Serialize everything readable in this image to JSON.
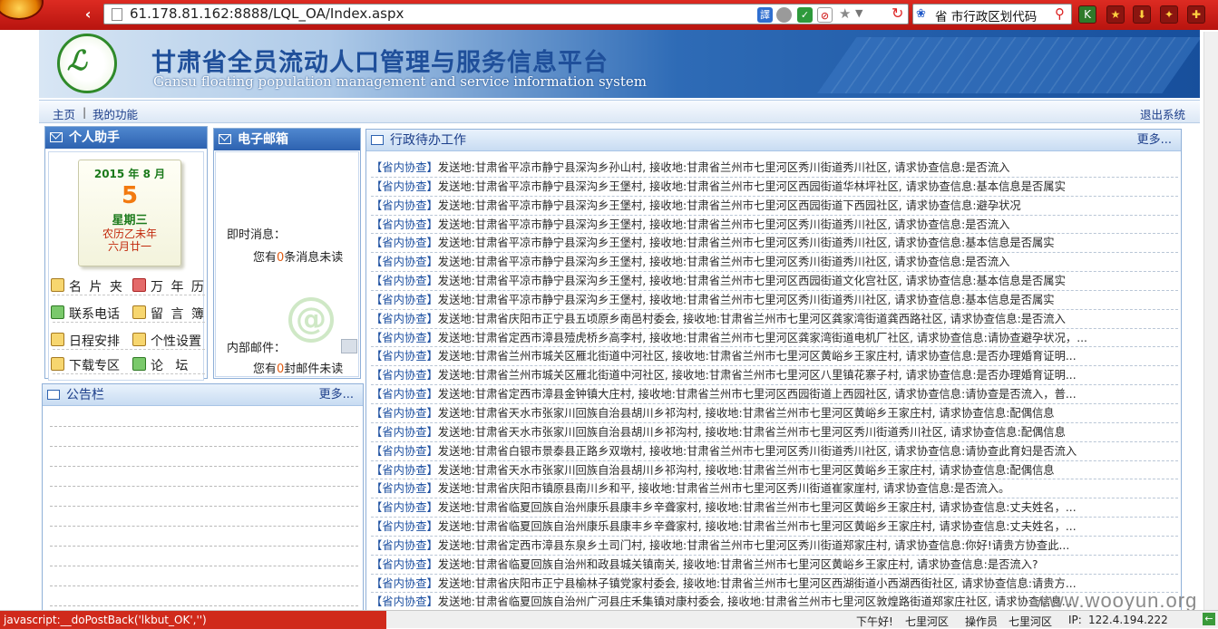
{
  "browser": {
    "url": "61.178.81.162:8888/LQL_OA/Index.aspx",
    "search_text": "省 市行政区划代码"
  },
  "banner": {
    "title": "甘肃省全员流动人口管理与服务信息平台",
    "subtitle": "Gansu floating population management and service information system"
  },
  "nav": {
    "home": "主页",
    "sep": "|",
    "my_functions": "我的功能",
    "logout": "退出系统"
  },
  "assistant": {
    "title": "个人助手",
    "calendar": {
      "year_month": "2015 年 8 月",
      "day": "5",
      "weekday": "星期三",
      "lunar_year": "农历乙未年",
      "lunar_date": "六月廿一"
    },
    "tools": [
      "名 片 夹",
      "万 年 历",
      "联系电话",
      "留 言 簿",
      "日程安排",
      "个性设置",
      "下载专区",
      "论   坛"
    ]
  },
  "mailbox": {
    "title": "电子邮箱",
    "instant_label": "即时消息：",
    "instant_prefix": "您有",
    "instant_count": "0",
    "instant_suffix": "条消息未读",
    "internal_label": "内部邮件：",
    "internal_prefix": "您有",
    "internal_count": "0",
    "internal_suffix": "封邮件未读"
  },
  "notice": {
    "title": "公告栏",
    "more": "更多..."
  },
  "work": {
    "title": "行政待办工作",
    "more": "更多...",
    "rows": [
      "【省内协查】发送地:甘肃省平凉市静宁县深沟乡孙山村, 接收地:甘肃省兰州市七里河区秀川街道秀川社区, 请求协查信息:是否流入",
      "【省内协查】发送地:甘肃省平凉市静宁县深沟乡王堡村, 接收地:甘肃省兰州市七里河区西园街道华林坪社区, 请求协查信息:基本信息是否属实",
      "【省内协查】发送地:甘肃省平凉市静宁县深沟乡王堡村, 接收地:甘肃省兰州市七里河区西园街道下西园社区, 请求协查信息:避孕状况",
      "【省内协查】发送地:甘肃省平凉市静宁县深沟乡王堡村, 接收地:甘肃省兰州市七里河区秀川街道秀川社区, 请求协查信息:是否流入",
      "【省内协查】发送地:甘肃省平凉市静宁县深沟乡王堡村, 接收地:甘肃省兰州市七里河区秀川街道秀川社区, 请求协查信息:基本信息是否属实",
      "【省内协查】发送地:甘肃省平凉市静宁县深沟乡王堡村, 接收地:甘肃省兰州市七里河区秀川街道秀川社区, 请求协查信息:是否流入",
      "【省内协查】发送地:甘肃省平凉市静宁县深沟乡王堡村, 接收地:甘肃省兰州市七里河区西园街道文化宫社区, 请求协查信息:基本信息是否属实",
      "【省内协查】发送地:甘肃省平凉市静宁县深沟乡王堡村, 接收地:甘肃省兰州市七里河区秀川街道秀川社区, 请求协查信息:基本信息是否属实",
      "【省内协查】发送地:甘肃省庆阳市正宁县五顷原乡南邑村委会, 接收地:甘肃省兰州市七里河区龚家湾街道龚西路社区, 请求协查信息:是否流入",
      "【省内协查】发送地:甘肃省定西市漳县殪虎桥乡高李村, 接收地:甘肃省兰州市七里河区龚家湾街道电机厂社区, 请求协查信息:请协查避孕状况，...",
      "【省内协查】发送地:甘肃省兰州市城关区雁北街道中河社区, 接收地:甘肃省兰州市七里河区黄峪乡王家庄村, 请求协查信息:是否办理婚育证明...",
      "【省内协查】发送地:甘肃省兰州市城关区雁北街道中河社区, 接收地:甘肃省兰州市七里河区八里镇花寨子村, 请求协查信息:是否办理婚育证明...",
      "【省内协查】发送地:甘肃省定西市漳县金钟镇大庄村, 接收地:甘肃省兰州市七里河区西园街道上西园社区, 请求协查信息:请协查是否流入，普...",
      "【省内协查】发送地:甘肃省天水市张家川回族自治县胡川乡祁沟村, 接收地:甘肃省兰州市七里河区黄峪乡王家庄村, 请求协查信息:配偶信息",
      "【省内协查】发送地:甘肃省天水市张家川回族自治县胡川乡祁沟村, 接收地:甘肃省兰州市七里河区秀川街道秀川社区, 请求协查信息:配偶信息",
      "【省内协查】发送地:甘肃省白银市景泰县正路乡双墩村, 接收地:甘肃省兰州市七里河区秀川街道秀川社区, 请求协查信息:请协查此育妇是否流入",
      "【省内协查】发送地:甘肃省天水市张家川回族自治县胡川乡祁沟村, 接收地:甘肃省兰州市七里河区黄峪乡王家庄村, 请求协查信息:配偶信息",
      "【省内协查】发送地:甘肃省庆阳市镇原县南川乡和平, 接收地:甘肃省兰州市七里河区秀川街道崔家崖村, 请求协查信息:是否流入。",
      "【省内协查】发送地:甘肃省临夏回族自治州康乐县康丰乡辛聋家村, 接收地:甘肃省兰州市七里河区黄峪乡王家庄村, 请求协查信息:丈夫姓名，...",
      "【省内协查】发送地:甘肃省临夏回族自治州康乐县康丰乡辛聋家村, 接收地:甘肃省兰州市七里河区黄峪乡王家庄村, 请求协查信息:丈夫姓名，...",
      "【省内协查】发送地:甘肃省定西市漳县东泉乡土司门村, 接收地:甘肃省兰州市七里河区秀川街道郑家庄村, 请求协查信息:你好!请贵方协查此...",
      "【省内协查】发送地:甘肃省临夏回族自治州和政县城关镇南关, 接收地:甘肃省兰州市七里河区黄峪乡王家庄村, 请求协查信息:是否流入?",
      "【省内协查】发送地:甘肃省庆阳市正宁县榆林子镇党家村委会, 接收地:甘肃省兰州市七里河区西湖街道小西湖西街社区, 请求协查信息:请贵方...",
      "【省内协查】发送地:甘肃省临夏回族自治州广河县庄禾集镇对康村委会, 接收地:甘肃省兰州市七里河区敦煌路街道郑家庄社区, 请求协查信息..."
    ]
  },
  "status": {
    "js_link": "javascript:__doPostBack('lkbut_OK','')",
    "greeting": "下午好!",
    "district": "七里河区",
    "operator_label": "操作员",
    "operator": "七里河区",
    "ip_label": "IP:",
    "ip": "122.4.194.222"
  },
  "watermark": "www.wooyun.org"
}
